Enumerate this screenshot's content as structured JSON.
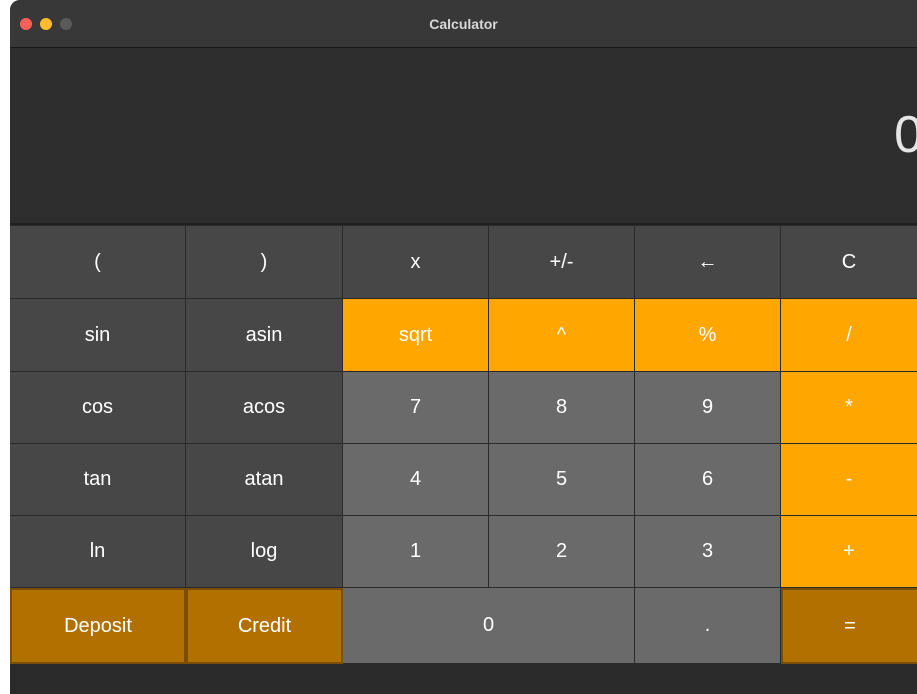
{
  "window": {
    "title": "Calculator"
  },
  "display": {
    "value": "0"
  },
  "keys": {
    "open_paren": "(",
    "close_paren": ")",
    "x": "x",
    "plus_minus": "+/-",
    "backspace": "←",
    "clear": "C",
    "sin": "sin",
    "asin": "asin",
    "sqrt": "sqrt",
    "power": "^",
    "percent": "%",
    "divide": "/",
    "cos": "cos",
    "acos": "acos",
    "seven": "7",
    "eight": "8",
    "nine": "9",
    "multiply": "*",
    "tan": "tan",
    "atan": "atan",
    "four": "4",
    "five": "5",
    "six": "6",
    "minus": "-",
    "ln": "ln",
    "log": "log",
    "one": "1",
    "two": "2",
    "three": "3",
    "plus": "+",
    "deposit": "Deposit",
    "credit": "Credit",
    "zero": "0",
    "decimal": ".",
    "equals": "="
  },
  "colors": {
    "function_key": "#474747",
    "digit_key": "#6a6a6a",
    "operator_key": "#ffa600",
    "finance_key": "#b27000"
  }
}
